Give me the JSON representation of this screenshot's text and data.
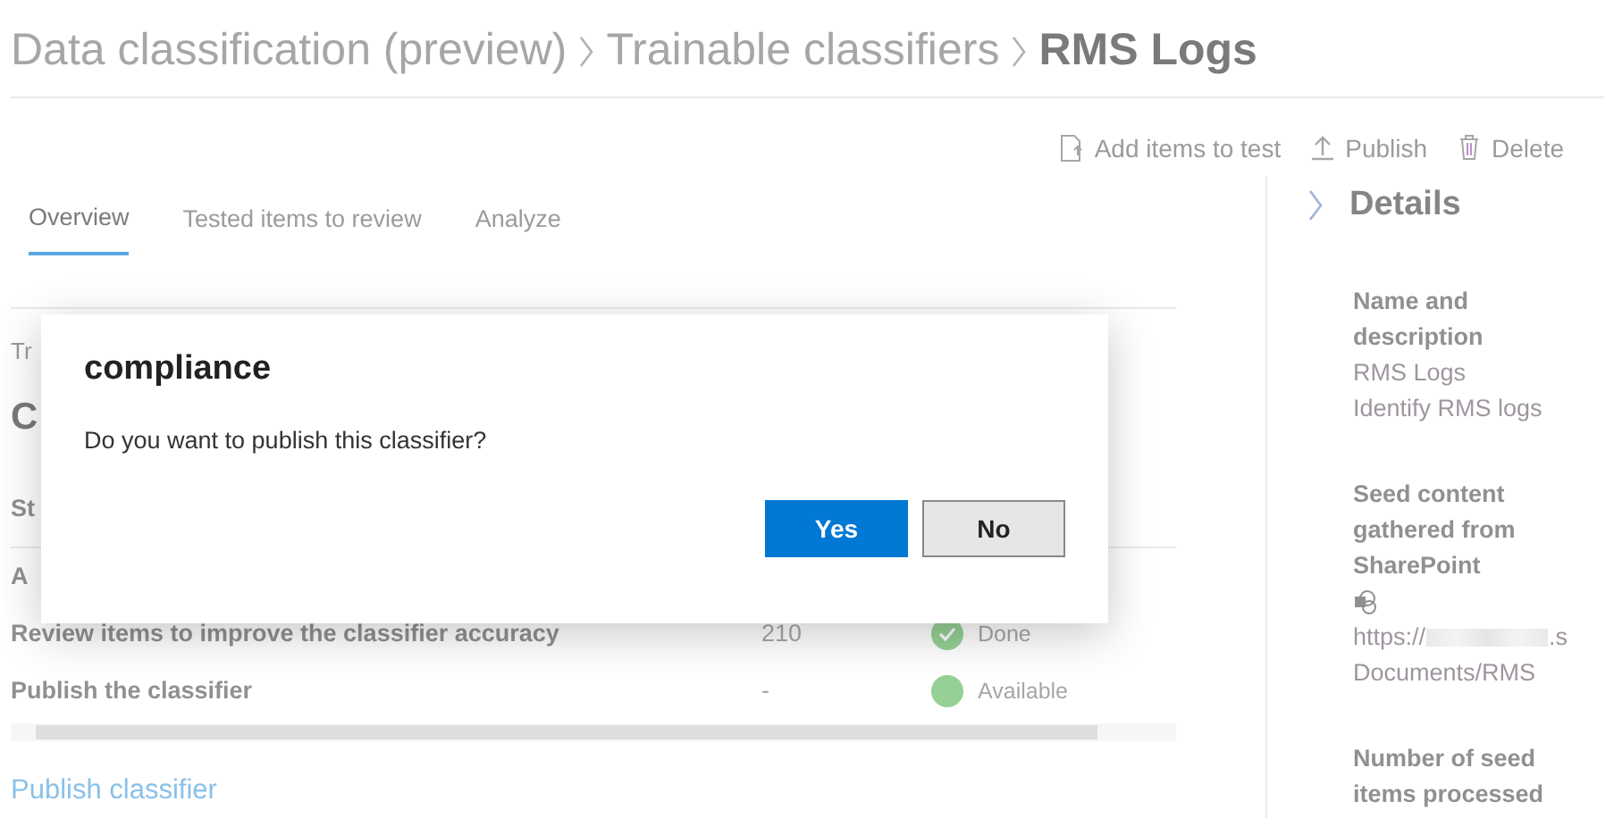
{
  "breadcrumb": [
    {
      "label": "Data classification (preview)",
      "current": false
    },
    {
      "label": "Trainable classifiers",
      "current": false
    },
    {
      "label": "RMS Logs",
      "current": true
    }
  ],
  "toolbar": [
    {
      "label": "Add items to test",
      "kind": "add"
    },
    {
      "label": "Publish",
      "kind": "publish"
    },
    {
      "label": "Delete",
      "kind": "delete"
    }
  ],
  "tabs": [
    {
      "label": "Overview",
      "selected": true
    },
    {
      "label": "Tested items to review",
      "selected": false
    },
    {
      "label": "Analyze",
      "selected": false
    }
  ],
  "hidden_fragments": [
    {
      "kind": "caption",
      "text": "Tr"
    },
    {
      "kind": "heading",
      "text": "C"
    },
    {
      "kind": "column",
      "text": "St"
    },
    {
      "kind": "row",
      "text": "A"
    }
  ],
  "table": {
    "rows": [
      {
        "step": "Review items to improve the classifier accuracy",
        "count": "210",
        "status": "Done",
        "kind": "done"
      },
      {
        "step": "Publish the classifier",
        "count": "-",
        "status": "Available",
        "kind": "available"
      }
    ]
  },
  "link": "Publish classifier",
  "details": {
    "title": "Details",
    "sections": [
      {
        "heading": "Name and description",
        "items": [
          {
            "kind": "text",
            "text": "RMS Logs"
          },
          {
            "kind": "text",
            "text": "Identify RMS logs"
          }
        ]
      },
      {
        "heading": "Seed content gathered from SharePoint",
        "items": [
          {
            "kind": "icon"
          },
          {
            "kind": "url",
            "start": "https://",
            "end": ".s"
          },
          {
            "kind": "text",
            "text": "Documents/RMS"
          }
        ]
      },
      {
        "heading": "Number of seed items processed"
      }
    ]
  },
  "dialog": {
    "title": "compliance",
    "message": "Do you want to publish this classifier?",
    "buttons": [
      {
        "label": "Yes",
        "primary": true
      },
      {
        "label": "No",
        "primary": false
      }
    ]
  }
}
